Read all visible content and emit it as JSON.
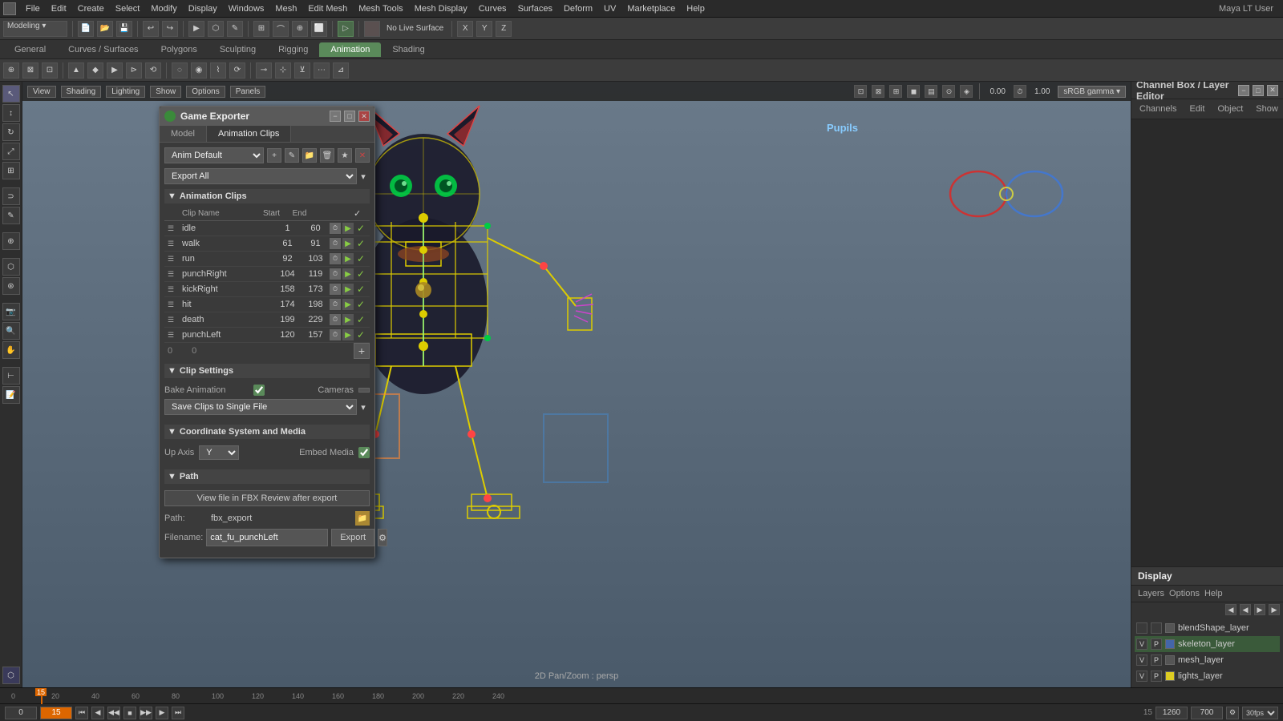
{
  "app": {
    "title": "Maya LT",
    "user": "Maya LT User"
  },
  "menu": {
    "items": [
      "File",
      "Edit",
      "Create",
      "Select",
      "Modify",
      "Display",
      "Windows",
      "Mesh",
      "Edit Mesh",
      "Mesh Tools",
      "Mesh Display",
      "Curves",
      "Surfaces",
      "Deform",
      "UV",
      "Marketplace",
      "Help"
    ]
  },
  "workflow_tabs": {
    "items": [
      "General",
      "Curves / Surfaces",
      "Polygons",
      "Sculpting",
      "Rigging",
      "Animation",
      "Shading"
    ],
    "active": "Animation"
  },
  "viewport": {
    "labels": [
      "View",
      "Shading",
      "Lighting",
      "Show",
      "Options",
      "Panels"
    ],
    "pupils_label": "Pupils",
    "pan_zoom_label": "2D Pan/Zoom : persp",
    "no_live_surface": "No Live Surface"
  },
  "game_exporter": {
    "title": "Game Exporter",
    "tabs": [
      "Model",
      "Animation Clips"
    ],
    "active_tab": "Animation Clips",
    "anim_default": "Anim Default",
    "export_all": "Export All",
    "sections": {
      "animation_clips": {
        "label": "Animation Clips",
        "columns": [
          "Clip Name",
          "Start",
          "End"
        ],
        "clips": [
          {
            "name": "idle",
            "start": "1",
            "end": "60"
          },
          {
            "name": "walk",
            "start": "61",
            "end": "91"
          },
          {
            "name": "run",
            "start": "92",
            "end": "103"
          },
          {
            "name": "punchRight",
            "start": "104",
            "end": "119"
          },
          {
            "name": "kickRight",
            "start": "158",
            "end": "173"
          },
          {
            "name": "hit",
            "start": "174",
            "end": "198"
          },
          {
            "name": "death",
            "start": "199",
            "end": "229"
          },
          {
            "name": "punchLeft",
            "start": "120",
            "end": "157"
          }
        ]
      },
      "clip_settings": {
        "label": "Clip Settings",
        "bake_animation_label": "Bake Animation",
        "cameras_label": "Cameras",
        "save_clips_label": "Save Clips to Single File"
      },
      "coordinate_system": {
        "label": "Coordinate System and Media",
        "up_axis_label": "Up Axis",
        "up_axis_value": "Y",
        "embed_media_label": "Embed Media"
      },
      "path": {
        "label": "Path",
        "view_btn": "View file in FBX Review after export",
        "path_label": "Path:",
        "path_value": "fbx_export",
        "filename_label": "Filename:",
        "filename_value": "cat_fu_punchLeft",
        "export_btn": "Export"
      }
    }
  },
  "right_panel": {
    "title": "Channel Box / Layer Editor",
    "tabs": [
      "Channels",
      "Edit",
      "Object",
      "Show"
    ],
    "display": {
      "title": "Display",
      "tabs": [
        "Layers",
        "Options",
        "Help"
      ],
      "layers": [
        {
          "name": "blendShape_layer",
          "v": "",
          "p": "",
          "color": "#555555",
          "active": false
        },
        {
          "name": "skeleton_layer",
          "v": "V",
          "p": "P",
          "color": "#4466aa",
          "active": true
        },
        {
          "name": "mesh_layer",
          "v": "V",
          "p": "P",
          "color": "#555555",
          "active": false
        },
        {
          "name": "lights_layer",
          "v": "V",
          "p": "P",
          "color": "#ddcc22",
          "active": false
        }
      ]
    }
  },
  "timeline": {
    "markers": [
      "0",
      "20",
      "40",
      "60",
      "80",
      "100",
      "120",
      "140",
      "160",
      "180",
      "200",
      "220",
      "240"
    ],
    "current_frame": "15",
    "start_frame": "0",
    "end_frame": "240",
    "playback_start": "0",
    "playback_end": "240",
    "right_markers": [
      "1260",
      "700"
    ],
    "right_current": "15"
  }
}
